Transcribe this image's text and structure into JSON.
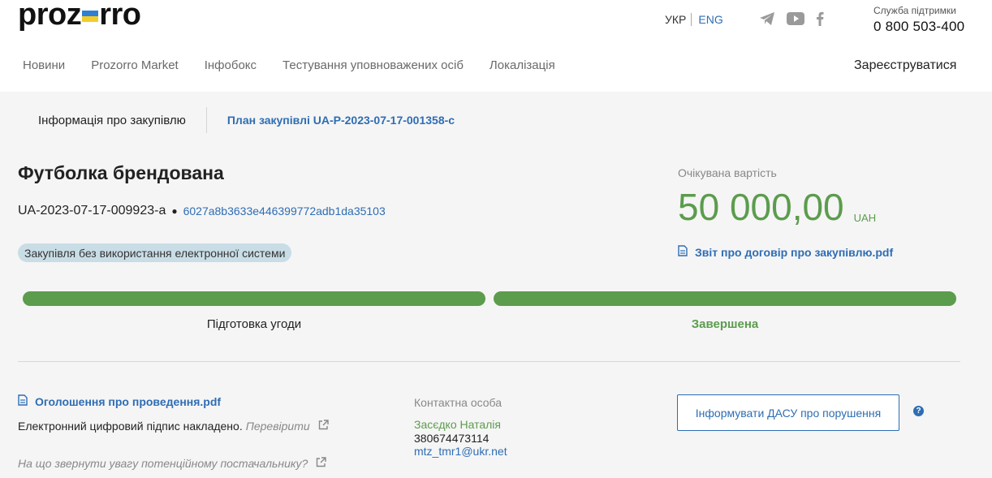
{
  "header": {
    "logo": {
      "before": "proz",
      "after": "rro"
    },
    "lang": {
      "ukr": "УКР",
      "eng": "ENG"
    },
    "socials": [
      "telegram-icon",
      "youtube-icon",
      "facebook-icon"
    ],
    "support": {
      "label": "Служба підтримки",
      "phone": "0 800 503-400"
    },
    "nav": [
      "Новини",
      "Prozorro Market",
      "Інфобокс",
      "Тестування уповноважених осіб",
      "Локалізація"
    ],
    "register": "Зареєструватися"
  },
  "tabs": {
    "info": "Інформація про закупівлю",
    "plan": "План закупівлі UA-P-2023-07-17-001358-c"
  },
  "tender": {
    "title": "Футболка брендована",
    "id": "UA-2023-07-17-009923-a",
    "hash": "6027a8b3633e446399772adb1da35103",
    "badge": "Закупівля без використання електронної системи",
    "expected_label": "Очікувана вартість",
    "amount": "50 000,00",
    "currency": "UAH",
    "report": "Звіт про договір про закупівлю.pdf"
  },
  "progress": {
    "steps": [
      {
        "label": "Підготовка угоди",
        "fill": 1.0
      },
      {
        "label": "Завершена",
        "fill": 1.0
      }
    ]
  },
  "bottom": {
    "announcement": "Оголошення про проведення.pdf",
    "signature": "Електронний цифровий підпис накладено.",
    "verify": "Перевірити",
    "attention": "На що звернути увагу потенційному постачальнику?",
    "contact_label": "Контактна особа",
    "contact_name": "Засєдко Наталія",
    "contact_phone": "380674473114",
    "contact_email": "mtz_tmr1@ukr.net",
    "dasu_button": "Інформувати ДАСУ про порушення",
    "help": "?"
  },
  "colors": {
    "accent": "#2e6db4",
    "success": "#5c9c4d",
    "badge_bg": "#c9dde6"
  }
}
